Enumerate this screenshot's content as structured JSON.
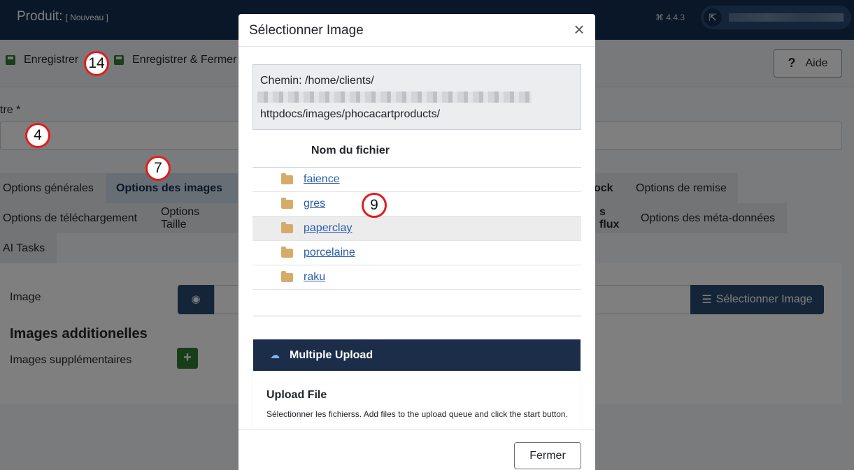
{
  "app": {
    "title": "Produit:",
    "subtitle": "[ Nouveau ]",
    "version": "4.4.3"
  },
  "toolbar": {
    "save_label": "Enregistrer",
    "save_close_label": "Enregistrer & Fermer",
    "help_label": "Aide",
    "help_icon": "?"
  },
  "form": {
    "title_label": "tre *",
    "tabs_row1": [
      "Options générales",
      "Options des images",
      "ock",
      "Options de remise"
    ],
    "tabs_row2": [
      "Options de téléchargement",
      "Options Taille",
      "s flux",
      "Options des méta-données"
    ],
    "tabs_row3": [
      "AI Tasks"
    ],
    "image_label": "Image",
    "select_image_label": "Sélectionner Image",
    "additional_images_heading": "Images additionelles",
    "extra_images_label": "Images supplémentaires",
    "plus": "+"
  },
  "markers": {
    "m14": "14",
    "m4": "4",
    "m7": "7",
    "m9": "9"
  },
  "modal": {
    "title": "Sélectionner Image",
    "close_glyph": "×",
    "path_line1": "Chemin: /home/clients/",
    "path_line3": "httpdocs/images/phocacartproducts/",
    "column_header": "Nom du fichier",
    "folders": [
      "faience",
      "gres",
      "paperclay",
      "porcelaine",
      "raku"
    ],
    "upload_header": "Multiple Upload",
    "upload_title": "Upload File",
    "upload_text": "Sélectionner les fichierss. Add files to the upload queue and click the start button.",
    "footer_close": "Fermer"
  },
  "colors": {
    "topbar": "#132f53",
    "primary_button": "#2b4a72",
    "save_icon": "#2f7d32",
    "marker_border": "#e11d1d",
    "link": "#2a5da8",
    "upload_header": "#1c2d49"
  }
}
